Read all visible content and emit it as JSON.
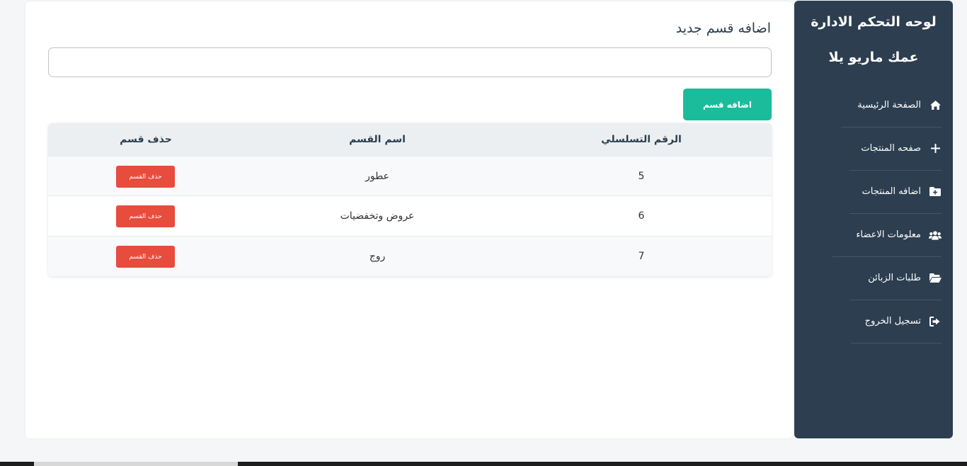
{
  "sidebar": {
    "title": "لوحه التحكم الادارة",
    "subtitle": "عمك ماريو يلا",
    "items": [
      {
        "label": "الصفحة الرئيسية",
        "icon": "home-icon"
      },
      {
        "label": "صفحه المنتجات",
        "icon": "plus-icon"
      },
      {
        "label": "اضافه المنتجات",
        "icon": "folder-plus-icon"
      },
      {
        "label": "معلومات الاعضاء",
        "icon": "users-icon"
      },
      {
        "label": "طلبات الزبائن",
        "icon": "folder-open-icon"
      },
      {
        "label": "تسجيل الخروج",
        "icon": "sign-out-icon"
      }
    ]
  },
  "main": {
    "title": "اضافه قسم جديد",
    "input_value": "",
    "add_button": "اضافه قسم"
  },
  "table": {
    "headers": {
      "serial": "الرقم التسلسلي",
      "name": "اسم القسم",
      "delete": "حذف قسم"
    },
    "rows": [
      {
        "serial": "5",
        "name": "عطور",
        "delete": "حذف القسم"
      },
      {
        "serial": "6",
        "name": "عروض وتخفضيات",
        "delete": "حذف القسم"
      },
      {
        "serial": "7",
        "name": "روج",
        "delete": "حذف القسم"
      }
    ]
  },
  "colors": {
    "sidebar": "#2c3e50",
    "accent": "#1abc9c",
    "danger": "#e74c3c"
  }
}
